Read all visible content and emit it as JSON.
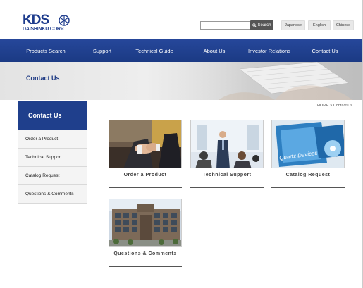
{
  "logo": {
    "top_text": "KDS",
    "bottom_text": "DAISHINKU CORP."
  },
  "search": {
    "placeholder": "",
    "button_label": "Search"
  },
  "languages": [
    "Japanese",
    "English",
    "Chinese"
  ],
  "nav": [
    "Products Search",
    "Support",
    "Technical Guide",
    "About Us",
    "Investor Relations",
    "Contact Us"
  ],
  "banner": {
    "title": "Contact Us"
  },
  "sidebar": {
    "heading": "Contact Us",
    "items": [
      "Order a Product",
      "Technical Support",
      "Catalog Request",
      "Questions & Comments"
    ]
  },
  "breadcrumb": "HOME > Contact Us",
  "cards": [
    {
      "label": "Order a Product"
    },
    {
      "label": "Technical Support"
    },
    {
      "label": "Catalog Request"
    },
    {
      "label": "Questions & Comments"
    }
  ],
  "catalog_image_text": "Quartz Devices",
  "colors": {
    "brand_blue": "#1f3f8c",
    "nav_text": "#ffffff",
    "sidebar_bg": "#f4f4f4"
  }
}
